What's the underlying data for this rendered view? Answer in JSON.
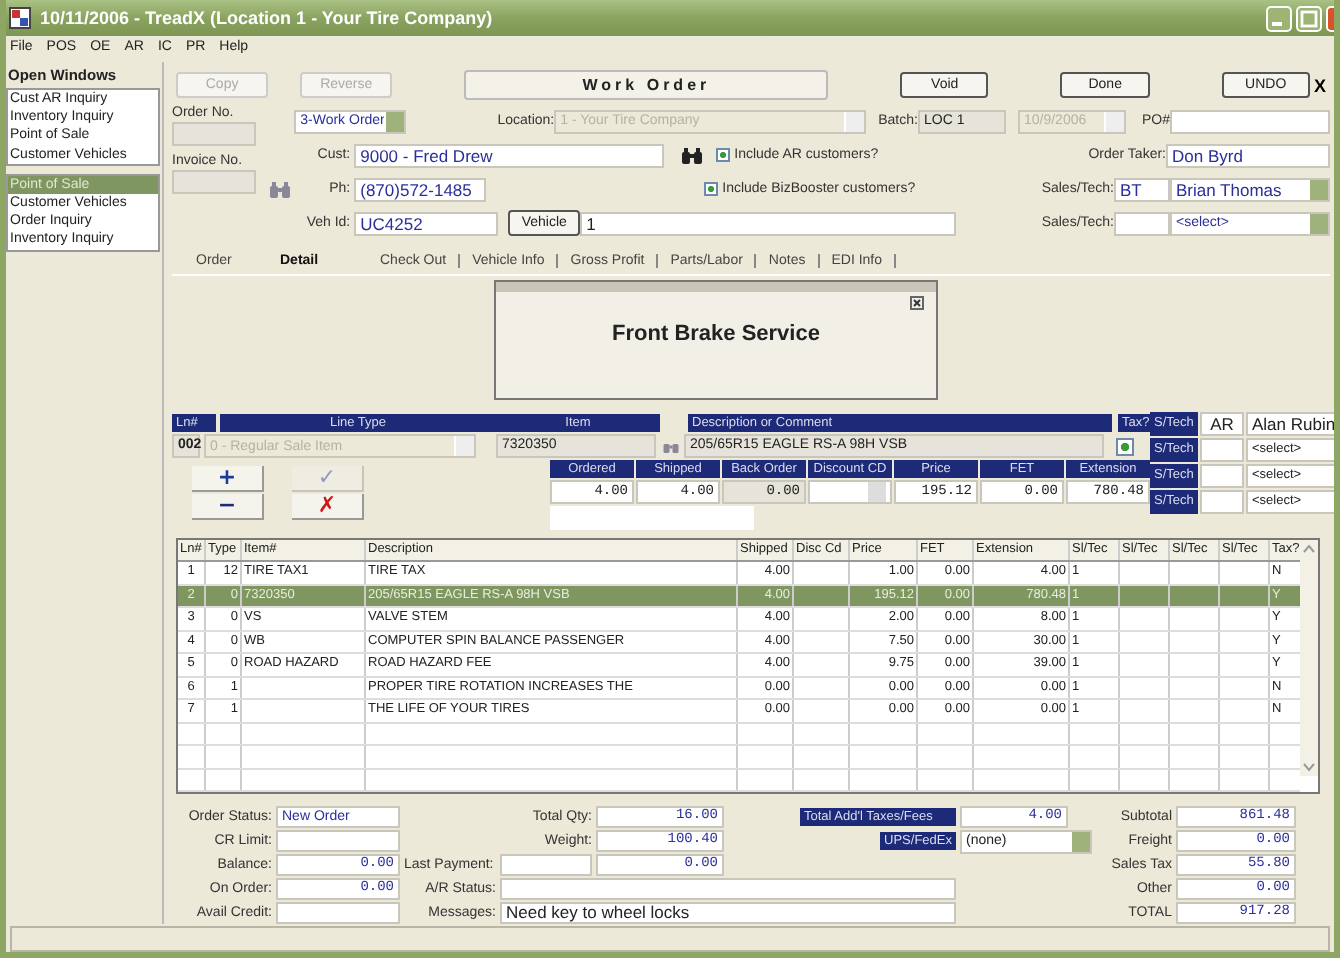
{
  "window": {
    "title": "10/11/2006 - TreadX (Location 1 - Your Tire Company)"
  },
  "menu": [
    "File",
    "POS",
    "OE",
    "AR",
    "IC",
    "PR",
    "Help"
  ],
  "sidebar": {
    "title": "Open Windows",
    "groups": [
      [
        {
          "label": "Cust AR Inquiry",
          "selected": false
        },
        {
          "label": "Inventory Inquiry",
          "selected": false
        },
        {
          "label": "Point of Sale",
          "selected": false
        },
        {
          "label": "Customer Vehicles",
          "selected": false
        }
      ],
      [
        {
          "label": "Point of Sale",
          "selected": true
        },
        {
          "label": "Customer Vehicles",
          "selected": false
        },
        {
          "label": "Order Inquiry",
          "selected": false
        },
        {
          "label": "Inventory Inquiry",
          "selected": false
        }
      ]
    ]
  },
  "toolbar": {
    "left_buttons": [
      {
        "label": "Copy",
        "disabled": true
      },
      {
        "label": "Reverse",
        "disabled": true
      }
    ],
    "form_title": "Work Order",
    "right_buttons": [
      {
        "label": "Void",
        "disabled": false
      },
      {
        "label": "Done",
        "disabled": false
      },
      {
        "label": "UNDO",
        "disabled": false
      }
    ],
    "close_label": "X"
  },
  "header": {
    "order_no": {
      "label": "Order No."
    },
    "invoice_no": {
      "label": "Invoice No."
    },
    "order_type": "3-Work Order",
    "location": {
      "label": "Location:",
      "value": "1 - Your Tire Company",
      "disabled": true
    },
    "batch": {
      "label": "Batch:",
      "value": "LOC 1"
    },
    "date": {
      "value": "10/9/2006",
      "disabled": true
    },
    "po": {
      "label": "PO#"
    },
    "customer": {
      "label": "Cust:",
      "value": "9000 - Fred Drew"
    },
    "phone": {
      "label": "Ph:",
      "value": "(870)572-1485"
    },
    "vehicle_id": {
      "label": "Veh Id:",
      "value": "UC4252"
    },
    "vehicle_button": "Vehicle",
    "vehicle_no": "1",
    "checkboxes": [
      {
        "label": "Include AR customers?",
        "checked": true
      },
      {
        "label": "Include BizBooster customers?",
        "checked": true
      }
    ],
    "order_taker": {
      "label": "Order Taker:",
      "value": "Don Byrd"
    },
    "sales_techs": [
      {
        "label": "Sales/Tech:",
        "code": "BT",
        "name": "Brian Thomas"
      },
      {
        "label": "Sales/Tech:",
        "name": "<select>"
      }
    ]
  },
  "tabs": [
    {
      "label": "Order",
      "selected": false
    },
    {
      "label": "Detail",
      "selected": true
    },
    {
      "label": "Check Out",
      "selected": false
    },
    {
      "label": "Vehicle Info",
      "selected": false
    },
    {
      "label": "Gross Profit",
      "selected": false
    },
    {
      "label": "Parts/Labor",
      "selected": false
    },
    {
      "label": "Notes",
      "selected": false
    },
    {
      "label": "EDI Info",
      "selected": false
    }
  ],
  "pending": {
    "text": "Front Brake Service"
  },
  "entry": {
    "line_no": {
      "label": "Ln#",
      "value": "002"
    },
    "line_type": {
      "label": "Line Type",
      "value": "0 - Regular Sale Item",
      "disabled": true
    },
    "item": {
      "label": "Item",
      "value": "7320350"
    },
    "description": {
      "label": "Description or Comment",
      "value": "205/65R15 EAGLE RS-A 98H VSB"
    },
    "tax": {
      "label": "Tax?",
      "checked": true
    },
    "amounts": [
      {
        "label": "Ordered",
        "value": "4.00",
        "kind": "field"
      },
      {
        "label": "Shipped",
        "value": "4.00",
        "kind": "field"
      },
      {
        "label": "Back Order",
        "value": "0.00",
        "kind": "readonly"
      },
      {
        "label": "Discount CD",
        "kind": "select"
      },
      {
        "label": "Price",
        "value": "195.12",
        "kind": "field"
      },
      {
        "label": "FET",
        "value": "0.00",
        "kind": "field"
      },
      {
        "label": "Extension",
        "value": "780.48",
        "kind": "field"
      }
    ],
    "buttons": [
      {
        "symbol": "+",
        "kind": "add",
        "disabled": false
      },
      {
        "symbol": "✓",
        "kind": "confirm",
        "disabled": true
      },
      {
        "symbol": "−",
        "kind": "remove",
        "disabled": false
      },
      {
        "symbol": "✗",
        "kind": "cancel",
        "disabled": false
      }
    ],
    "sales_techs": [
      {
        "label": "S/Tech",
        "code": "AR",
        "name": "Alan Rubin"
      },
      {
        "label": "S/Tech",
        "name": "<select>"
      },
      {
        "label": "S/Tech",
        "name": "<select>"
      },
      {
        "label": "S/Tech",
        "name": "<select>"
      }
    ]
  },
  "table": {
    "columns": [
      "Ln#",
      "Type",
      "Item#",
      "Description",
      "Shipped",
      "Disc Cd",
      "Price",
      "FET",
      "Extension",
      "Sl/Tec",
      "Sl/Tec",
      "Sl/Tec",
      "Sl/Tec",
      "Tax?"
    ],
    "rows": [
      {
        "cells": [
          "1",
          "12",
          "TIRE TAX1",
          "TIRE TAX",
          "4.00",
          null,
          "1.00",
          "0.00",
          "4.00",
          "1",
          null,
          null,
          null,
          "N"
        ],
        "selected": false
      },
      {
        "cells": [
          "2",
          "0",
          "7320350",
          "205/65R15 EAGLE RS-A 98H VSB",
          "4.00",
          null,
          "195.12",
          "0.00",
          "780.48",
          "1",
          null,
          null,
          null,
          "Y"
        ],
        "selected": true
      },
      {
        "cells": [
          "3",
          "0",
          "VS",
          "VALVE STEM",
          "4.00",
          null,
          "2.00",
          "0.00",
          "8.00",
          "1",
          null,
          null,
          null,
          "Y"
        ],
        "selected": false
      },
      {
        "cells": [
          "4",
          "0",
          "WB",
          "COMPUTER SPIN BALANCE PASSENGER",
          "4.00",
          null,
          "7.50",
          "0.00",
          "30.00",
          "1",
          null,
          null,
          null,
          "Y"
        ],
        "selected": false
      },
      {
        "cells": [
          "5",
          "0",
          "ROAD HAZARD",
          "ROAD HAZARD FEE",
          "4.00",
          null,
          "9.75",
          "0.00",
          "39.00",
          "1",
          null,
          null,
          null,
          "Y"
        ],
        "selected": false
      },
      {
        "cells": [
          "6",
          "1",
          null,
          "PROPER TIRE ROTATION INCREASES THE",
          "0.00",
          null,
          "0.00",
          "0.00",
          "0.00",
          "1",
          null,
          null,
          null,
          "N"
        ],
        "selected": false
      },
      {
        "cells": [
          "7",
          "1",
          null,
          "THE LIFE OF YOUR TIRES",
          "0.00",
          null,
          "0.00",
          "0.00",
          "0.00",
          "1",
          null,
          null,
          null,
          "N"
        ],
        "selected": false
      }
    ]
  },
  "footer": {
    "order_status": {
      "label": "Order Status:",
      "value": "New Order"
    },
    "cr_limit": {
      "label": "CR Limit:"
    },
    "balance": {
      "label": "Balance:",
      "value": "0.00"
    },
    "on_order": {
      "label": "On Order:",
      "value": "0.00"
    },
    "avail_credit": {
      "label": "Avail Credit:"
    },
    "total_qty": {
      "label": "Total Qty:",
      "value": "16.00"
    },
    "weight": {
      "label": "Weight:",
      "value": "100.40"
    },
    "last_payment": {
      "label": "Last Payment:",
      "amount": "0.00"
    },
    "ar_status": {
      "label": "A/R Status:"
    },
    "messages": {
      "label": "Messages:",
      "value": "Need key to wheel locks"
    },
    "addl_taxes": {
      "label": "Total Add'l Taxes/Fees",
      "value": "4.00"
    },
    "shipper": {
      "label": "UPS/FedEx",
      "value": "(none)"
    },
    "totals": [
      {
        "label": "Subtotal",
        "value": "861.48"
      },
      {
        "label": "Freight",
        "value": "0.00"
      },
      {
        "label": "Sales Tax",
        "value": "55.80"
      },
      {
        "label": "Other",
        "value": "0.00"
      },
      {
        "label": "TOTAL",
        "value": "917.28"
      }
    ]
  }
}
